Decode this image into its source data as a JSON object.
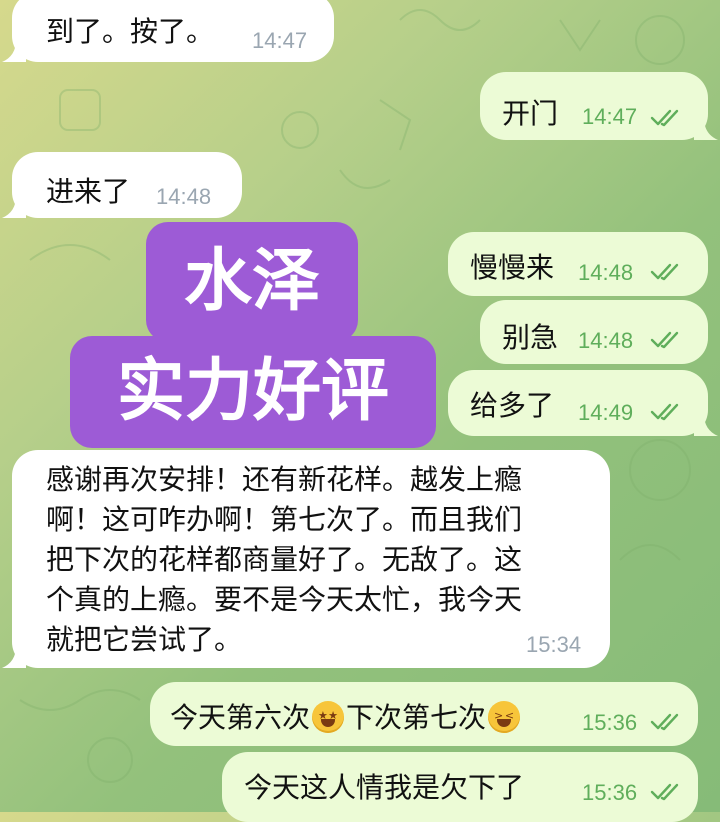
{
  "messages": [
    {
      "text": "到了。按了。",
      "time": "14:47"
    },
    {
      "text": "开门",
      "time": "14:47"
    },
    {
      "text": "进来了",
      "time": "14:48"
    },
    {
      "text": "慢慢来",
      "time": "14:48"
    },
    {
      "text": "别急",
      "time": "14:48"
    },
    {
      "text": "给多了",
      "time": "14:49"
    },
    {
      "lines": [
        "感谢再次安排！还有新花样。越发上瘾",
        "啊！这可咋办啊！第七次了。而且我们",
        "把下次的花样都商量好了。无敌了。这",
        "个真的上瘾。要不是今天太忙，我今天",
        "就把它尝试了。"
      ],
      "time": "15:34"
    },
    {
      "text_a": "今天第六次",
      "text_b": "下次第七次",
      "time": "15:36"
    },
    {
      "text": "今天这人情我是欠下了",
      "time": "15:36"
    }
  ],
  "overlay": {
    "line1": "水泽",
    "line2": "实力好评"
  },
  "emoji": {
    "first": "star-struck-emoji",
    "second": "grinning-squinting-emoji"
  },
  "colors": {
    "incoming": "#ffffff",
    "outgoing": "#ecfbd6",
    "check": "#5fae5b",
    "badge": "#9d5bd6"
  }
}
